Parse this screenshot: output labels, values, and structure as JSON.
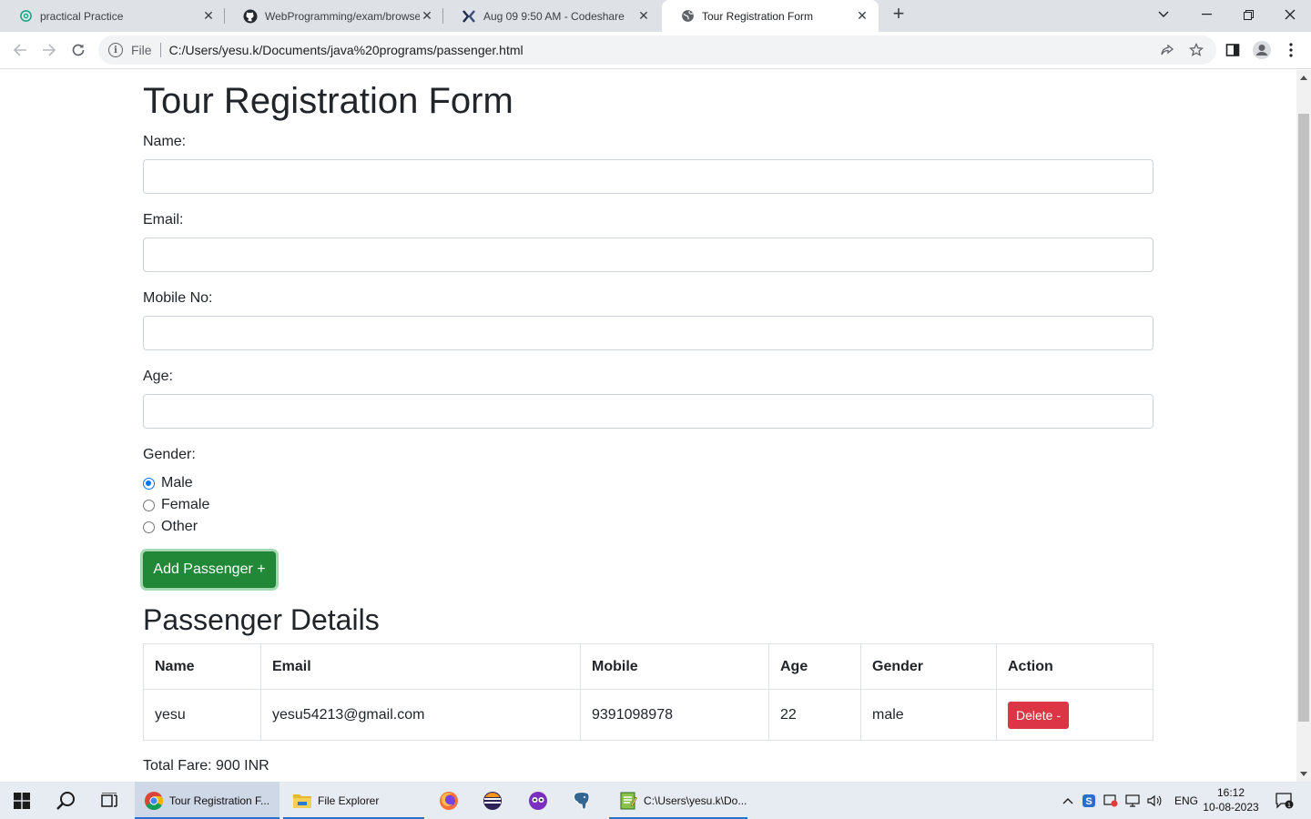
{
  "browser": {
    "tabs": [
      {
        "title": "practical Practice",
        "favicon": "chatgpt-icon"
      },
      {
        "title": "WebProgramming/exam/browse",
        "favicon": "github-icon"
      },
      {
        "title": "Aug 09 9:50 AM - Codeshare",
        "favicon": "codeshare-icon"
      },
      {
        "title": "Tour Registration Form",
        "favicon": "globe-icon"
      }
    ],
    "address": {
      "scheme": "File",
      "url": "C:/Users/yesu.k/Documents/java%20programs/passenger.html"
    }
  },
  "form": {
    "title": "Tour Registration Form",
    "name_label": "Name:",
    "name_value": "",
    "email_label": "Email:",
    "email_value": "",
    "mobile_label": "Mobile No:",
    "mobile_value": "",
    "age_label": "Age:",
    "age_value": "",
    "gender_label": "Gender:",
    "gender_options": [
      {
        "label": "Male",
        "checked": true
      },
      {
        "label": "Female",
        "checked": false
      },
      {
        "label": "Other",
        "checked": false
      }
    ],
    "add_button": "Add Passenger +"
  },
  "passengers": {
    "heading": "Passenger Details",
    "columns": [
      "Name",
      "Email",
      "Mobile",
      "Age",
      "Gender",
      "Action"
    ],
    "rows": [
      {
        "name": "yesu",
        "email": "yesu54213@gmail.com",
        "mobile": "9391098978",
        "age": "22",
        "gender": "male",
        "action": "Delete -"
      }
    ],
    "total_fare": "Total Fare: 900 INR"
  },
  "taskbar": {
    "apps": [
      {
        "label": "Tour Registration F..."
      },
      {
        "label": "File Explorer"
      },
      {
        "label": "C:\\Users\\yesu.k\\Do..."
      }
    ],
    "language": "ENG",
    "time": "16:12",
    "date": "10-08-2023",
    "notification_count": "1"
  },
  "colors": {
    "success": "#218838",
    "danger": "#dc3545",
    "radio_accent": "#0075ff",
    "taskbar_accent": "#2b6fce"
  }
}
